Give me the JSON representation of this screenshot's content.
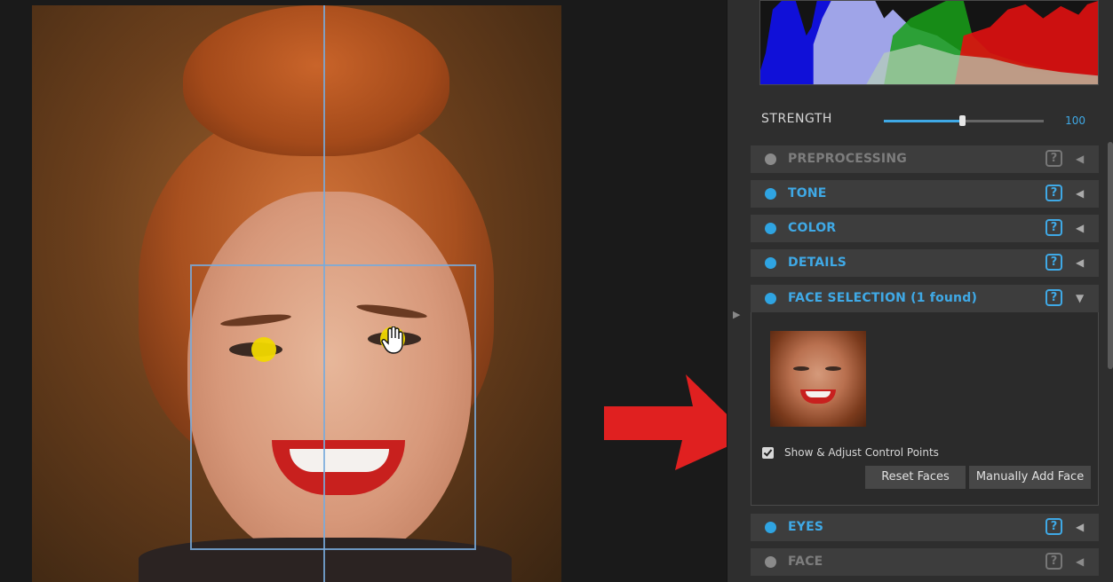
{
  "panel": {
    "strength": {
      "label": "STRENGTH",
      "value": "100",
      "level_fraction": 0.49
    },
    "sections_top": [
      {
        "title": "PREPROCESSING",
        "state": "inactive",
        "help": "?"
      },
      {
        "title": "TONE",
        "state": "active",
        "help": "?"
      },
      {
        "title": "COLOR",
        "state": "active",
        "help": "?"
      },
      {
        "title": "DETAILS",
        "state": "active",
        "help": "?"
      },
      {
        "title": "FACE SELECTION (1 found)",
        "state": "active",
        "help": "?",
        "expanded": true
      }
    ],
    "face_selection": {
      "checkbox_label": "Show & Adjust Control Points",
      "checked": true,
      "reset_button": "Reset Faces",
      "add_button": "Manually Add Face"
    },
    "sections_bottom": [
      {
        "title": "EYES",
        "state": "active",
        "help": "?"
      },
      {
        "title": "FACE",
        "state": "inactive",
        "help": "?"
      }
    ]
  },
  "colors": {
    "accent": "#3fa9e6",
    "control_point": "#f0d800",
    "annotation_arrow": "#e02020"
  },
  "icons": [
    "collapse-arrow-icon",
    "expand-arrow-icon",
    "help-icon",
    "hand-cursor-icon",
    "panel-toggle-icon"
  ]
}
